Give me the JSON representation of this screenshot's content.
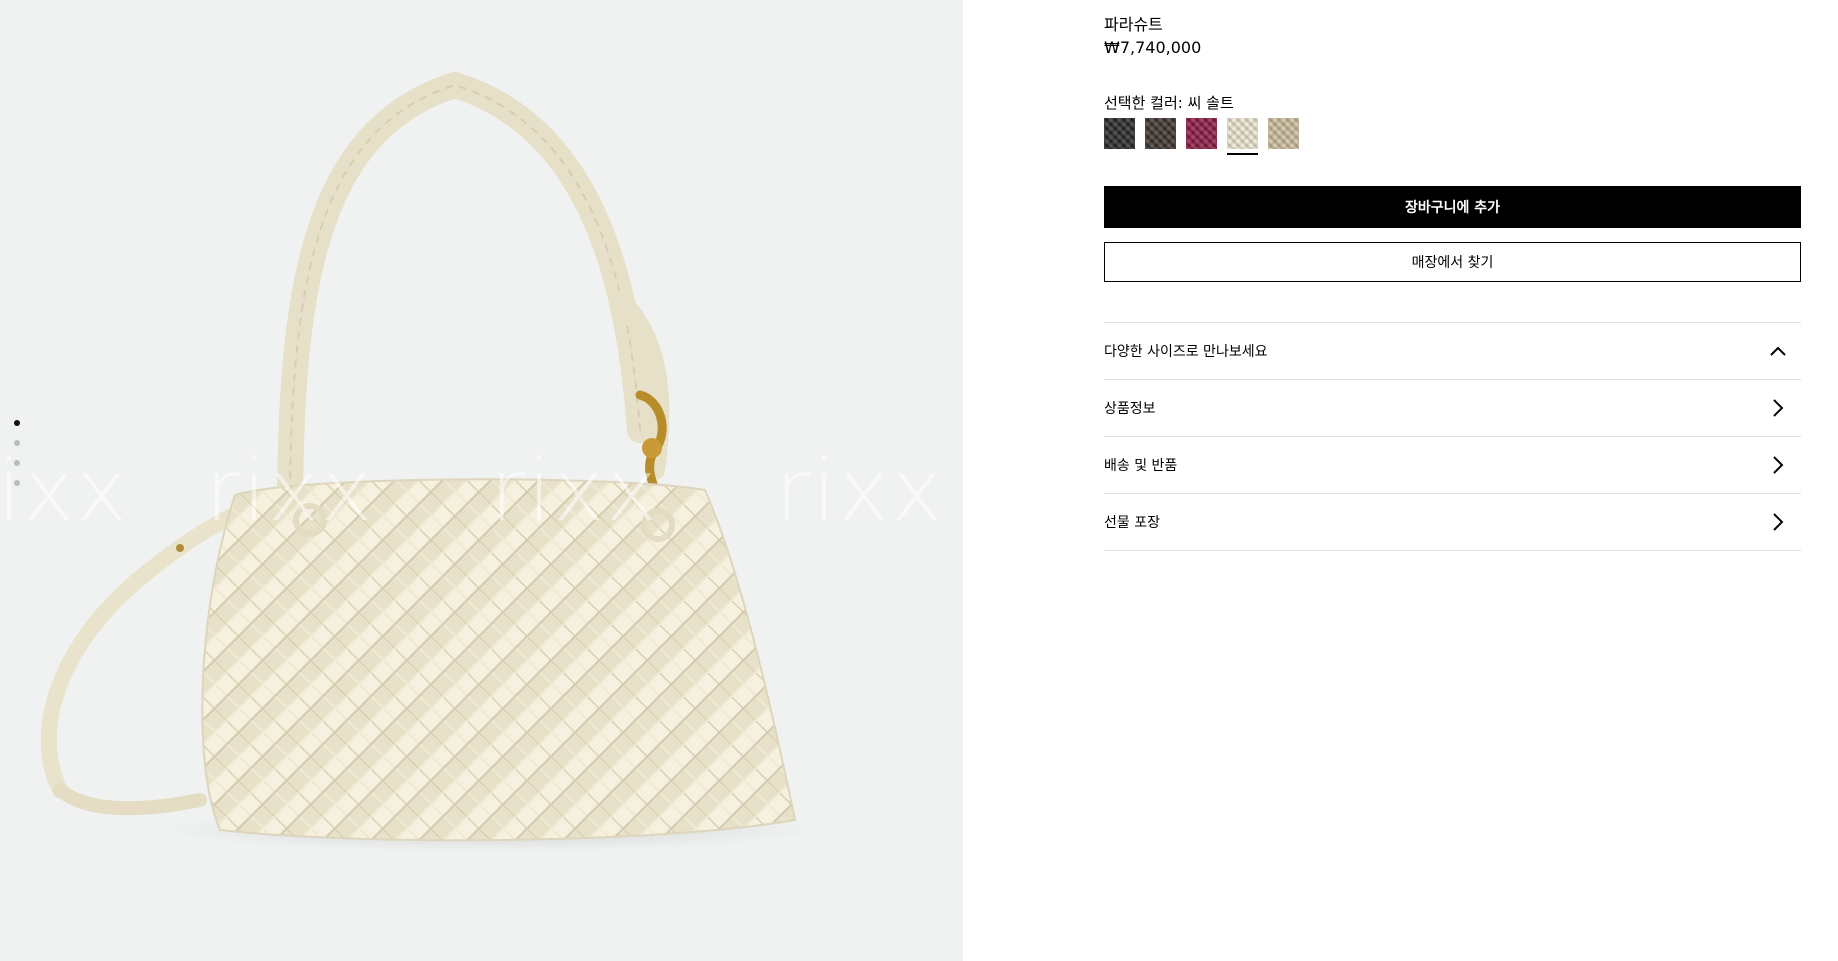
{
  "product": {
    "name": "파라슈트",
    "price": "₩7,740,000"
  },
  "color": {
    "label": "선택한 컬러: 씨 솔트",
    "swatches": [
      {
        "name": "black",
        "color": "#2a2a2a",
        "selected": false
      },
      {
        "name": "dark-brown",
        "color": "#3e3530",
        "selected": false
      },
      {
        "name": "magenta",
        "color": "#8c1c45",
        "selected": false
      },
      {
        "name": "sea-salt",
        "color": "#ece5d0",
        "selected": true
      },
      {
        "name": "beige",
        "color": "#cdbd9d",
        "selected": false
      }
    ]
  },
  "buttons": {
    "add_to_cart": "장바구니에 추가",
    "find_in_store": "매장에서 찾기"
  },
  "accordion": [
    {
      "label": "다양한 사이즈로 만나보세요",
      "icon": "chevron-up-icon"
    },
    {
      "label": "상품정보",
      "icon": "chevron-right-icon"
    },
    {
      "label": "배송 및 반품",
      "icon": "chevron-right-icon"
    },
    {
      "label": "선물 포장",
      "icon": "chevron-right-icon"
    }
  ],
  "gallery": {
    "watermark": "rixx",
    "slide_count": 4,
    "active_slide": 1
  }
}
